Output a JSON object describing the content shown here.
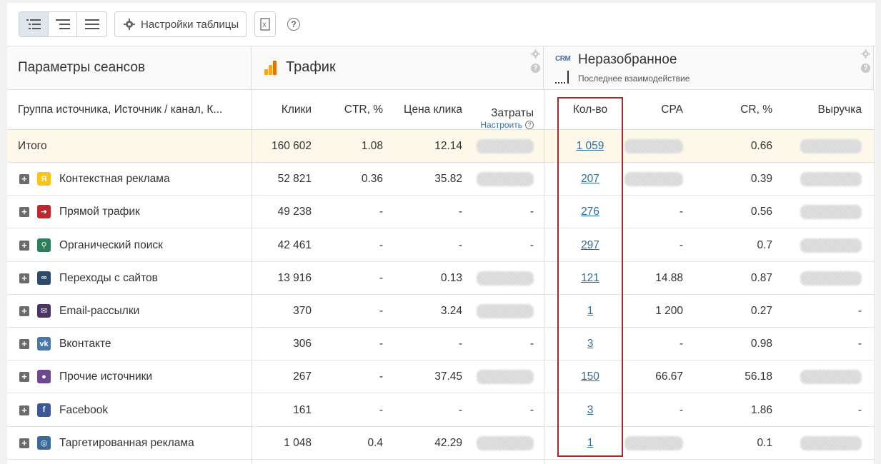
{
  "toolbar": {
    "settings_label": "Настройки таблицы",
    "views": [
      "tree-view-icon",
      "indent-view-icon",
      "flat-view-icon"
    ],
    "excel_icon": "excel-export-icon",
    "help": "?"
  },
  "groups": {
    "params_title": "Параметры сеансов",
    "traffic_title": "Трафик",
    "crm_logo": "CRM",
    "crm_title": "Неразобранное",
    "crm_subtitle": "Последнее взаимодействие"
  },
  "columns": {
    "source": "Группа источника, Источник / канал, К...",
    "clicks": "Клики",
    "ctr": "CTR, %",
    "cpc": "Цена клика",
    "cost": "Затраты",
    "cost_link": "Настроить",
    "qty": "Кол-во",
    "cpa": "CPA",
    "cr": "CR, %",
    "revenue": "Выручка"
  },
  "rows": [
    {
      "name": "Итого",
      "clicks": "160 602",
      "ctr": "1.08",
      "cpc": "12.14",
      "cost": "",
      "qty": "1 059",
      "cpa": "",
      "cr": "0.66",
      "revenue": ""
    },
    {
      "name": "Контекстная реклама",
      "icon": "yandex-icon",
      "icon_color": "#f8c31b",
      "clicks": "52 821",
      "ctr": "0.36",
      "cpc": "35.82",
      "cost": "",
      "qty": "207",
      "cpa": "",
      "cr": "0.39",
      "revenue": ""
    },
    {
      "name": "Прямой трафик",
      "icon": "direct-traffic-icon",
      "icon_color": "#c0262d",
      "clicks": "49 238",
      "ctr": "-",
      "cpc": "-",
      "cost": "-",
      "qty": "276",
      "cpa": "-",
      "cr": "0.56",
      "revenue": ""
    },
    {
      "name": "Органический поиск",
      "icon": "search-icon",
      "icon_color": "#2e7d5b",
      "clicks": "42 461",
      "ctr": "-",
      "cpc": "-",
      "cost": "-",
      "qty": "297",
      "cpa": "-",
      "cr": "0.7",
      "revenue": ""
    },
    {
      "name": "Переходы с сайтов",
      "icon": "link-icon",
      "icon_color": "#2d4a6b",
      "clicks": "13 916",
      "ctr": "-",
      "cpc": "0.13",
      "cost": "",
      "qty": "121",
      "cpa": "14.88",
      "cr": "0.87",
      "revenue": ""
    },
    {
      "name": "Email-рассылки",
      "icon": "email-icon",
      "icon_color": "#4a3560",
      "clicks": "370",
      "ctr": "-",
      "cpc": "3.24",
      "cost": "",
      "qty": "1",
      "cpa": "1 200",
      "cr": "0.27",
      "revenue": "-"
    },
    {
      "name": "Вконтакте",
      "icon": "vk-icon",
      "icon_color": "#4a76a8",
      "clicks": "306",
      "ctr": "-",
      "cpc": "-",
      "cost": "-",
      "qty": "3",
      "cpa": "-",
      "cr": "0.98",
      "revenue": "-"
    },
    {
      "name": "Прочие источники",
      "icon": "other-sources-icon",
      "icon_color": "#6a4a8c",
      "clicks": "267",
      "ctr": "-",
      "cpc": "37.45",
      "cost": "",
      "qty": "150",
      "cpa": "66.67",
      "cr": "56.18",
      "revenue": ""
    },
    {
      "name": "Facebook",
      "icon": "facebook-icon",
      "icon_color": "#3b5998",
      "clicks": "161",
      "ctr": "-",
      "cpc": "-",
      "cost": "-",
      "qty": "3",
      "cpa": "-",
      "cr": "1.86",
      "revenue": "-"
    },
    {
      "name": "Таргетированная реклама",
      "icon": "target-icon",
      "icon_color": "#3a6a9a",
      "clicks": "1 048",
      "ctr": "0.4",
      "cpc": "42.29",
      "cost": "",
      "qty": "1",
      "cpa": "",
      "cr": "0.1",
      "revenue": ""
    }
  ]
}
